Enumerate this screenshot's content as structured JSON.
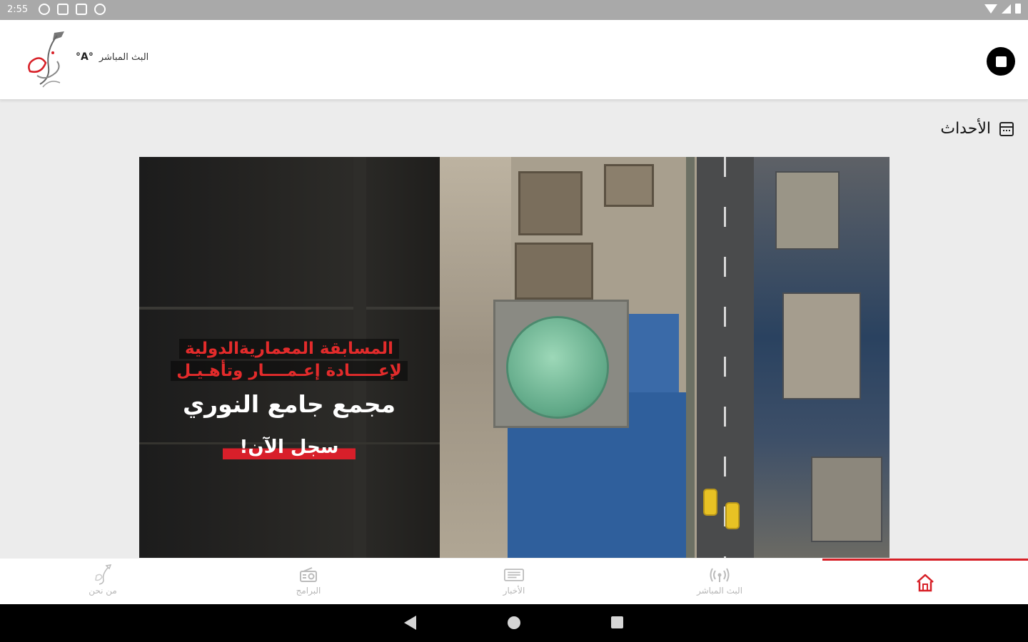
{
  "status_bar": {
    "time": "2:55"
  },
  "header": {
    "live_label": "البث المباشر",
    "live_icon_text": "°A°"
  },
  "section": {
    "title": "الأحداث"
  },
  "banner": {
    "line1": "المسابقة المعماريةالدولية",
    "line2": "لإعـــــادة إعـمــــار وتأهـيـل",
    "main": "مجمع جامع النوري",
    "cta": "سجل الآن!"
  },
  "bottom_nav": {
    "items": [
      {
        "label": "من نحن",
        "icon": "about-logo-icon"
      },
      {
        "label": "البرامج",
        "icon": "radio-icon"
      },
      {
        "label": "الأخبار",
        "icon": "news-icon"
      },
      {
        "label": "البث المباشر",
        "icon": "broadcast-icon"
      },
      {
        "label": "",
        "icon": "home-icon"
      }
    ],
    "active_index": 4
  },
  "colors": {
    "accent": "#d71f26",
    "inactive": "#b7b7b7"
  }
}
